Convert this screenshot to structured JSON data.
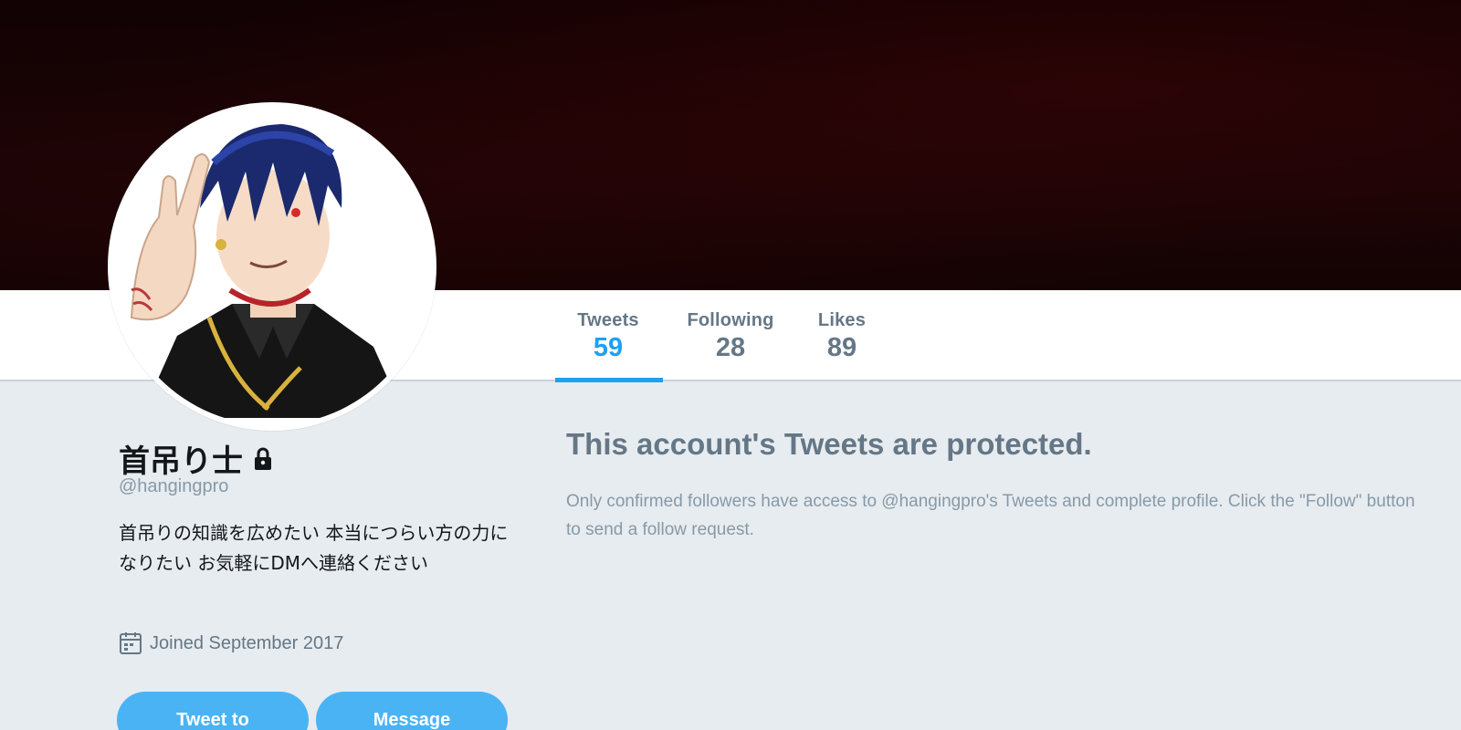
{
  "profile": {
    "name": "首吊り士",
    "handle": "@hangingpro",
    "bio": "首吊りの知識を広めたい 本当につらい方の力になりたい お気軽にDMへ連絡ください",
    "joined": "Joined September 2017",
    "protected": true
  },
  "nav": {
    "tabs": [
      {
        "label": "Tweets",
        "value": "59",
        "active": true
      },
      {
        "label": "Following",
        "value": "28",
        "active": false
      },
      {
        "label": "Likes",
        "value": "89",
        "active": false
      }
    ]
  },
  "actions": {
    "tweet_to_label": "Tweet to",
    "message_label": "Message"
  },
  "protected_notice": {
    "title": "This account's Tweets are protected.",
    "description": "Only confirmed followers have access to @hangingpro's Tweets and complete profile. Click the \"Follow\" button to send a follow request."
  },
  "icons": {
    "lock": "lock-icon",
    "calendar": "calendar-icon"
  },
  "colors": {
    "accent": "#1da1f2",
    "button": "#4ab3f4",
    "background": "#e6ecf0",
    "banner": "#1b0406"
  }
}
